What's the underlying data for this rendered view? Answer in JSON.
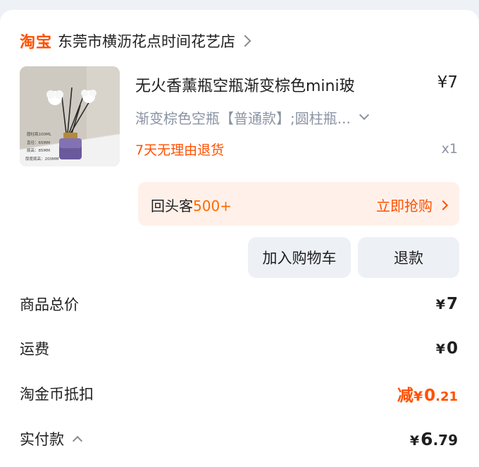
{
  "shop": {
    "logo_text": "淘宝",
    "name": "东莞市横沥花点时间花艺店"
  },
  "item": {
    "image_icon": "reed-diffuser-bottle-photo",
    "image_text": [
      "圆柱瓶100ML",
      "直径：65MM",
      "瓶高：85MM",
      "厚度瓶高：200MM"
    ],
    "title": "无火香薰瓶空瓶渐变棕色mini玻",
    "price": "¥7",
    "sku": "渐变棕色空瓶【普通款】;圆柱瓶...",
    "return_policy": "7天无理由退货",
    "quantity": "x1"
  },
  "promo": {
    "prefix": "回头客",
    "count": "500+",
    "action": "立即抢购"
  },
  "buttons": {
    "add_to_cart": "加入购物车",
    "refund": "退款"
  },
  "summary": {
    "goods_total_label": "商品总价",
    "goods_total_yen": "¥",
    "goods_total_value": "7",
    "shipping_label": "运费",
    "shipping_yen": "¥",
    "shipping_value": "0",
    "coin_label": "淘金币抵扣",
    "coin_prefix": "减",
    "coin_yen": "¥",
    "coin_int": "0",
    "coin_dec": ".21",
    "paid_label": "实付款",
    "paid_yen": "¥",
    "paid_int": "6",
    "paid_dec": ".79"
  },
  "colors": {
    "brand_orange": "#ff5000",
    "promo_bg": "#fff1e9",
    "button_bg": "#edf0f5",
    "muted_text": "#8a93a3"
  }
}
